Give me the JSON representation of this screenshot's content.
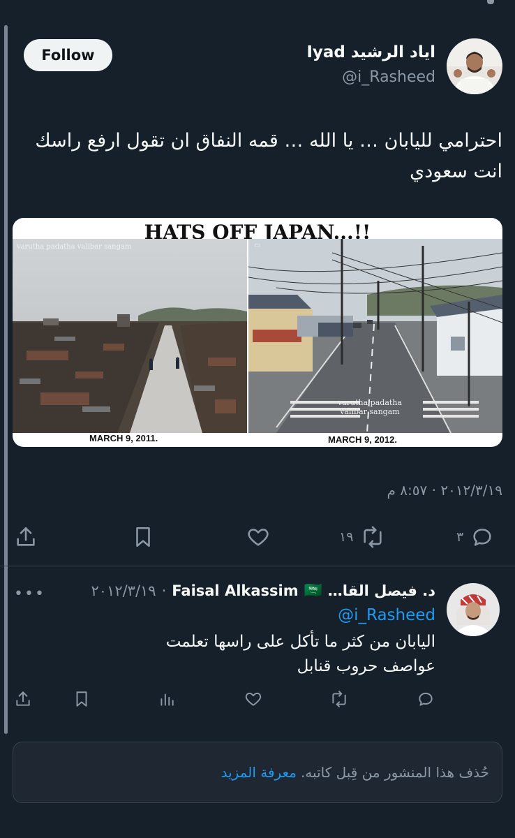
{
  "tweet": {
    "display_name": "اياد الرشيد Iyad",
    "handle": "@i_Rasheed",
    "follow_label": "Follow",
    "text_line1": "احترامي لليابان … يا الله … قمه النفاق ان تقول ارفع راسك",
    "text_line2": "انت سعودي",
    "media": {
      "title": "HATS OFF JAPAN...!!",
      "left_caption": "MARCH 9, 2011.",
      "right_caption": "MARCH 9, 2012.",
      "watermark": "varutha padatha valibar sangam",
      "watermark_line1": "varutha padatha",
      "watermark_line2": "valibar sangam"
    },
    "timestamp": "٢٠١٢/٣/١٩ · ٨:٥٧ م",
    "actions": {
      "replies": "٣",
      "retweets": "١٩"
    }
  },
  "reply": {
    "display_name": "د. فيصل القا…",
    "flag": "🇸🇦",
    "name_latin": "Faisal Alkassim",
    "time": "٢٠١٢/٣/١٩",
    "more_label": "•••",
    "mention": "@i_Rasheed",
    "text_line1": "اليابان من كثر ما تأكل على راسها تعلمت",
    "text_line2": "عواصف حروب قنابل"
  },
  "notice": {
    "text": "حُذف هذا المنشور من قِبل كاتبه.",
    "link": "معرفة المزيد"
  },
  "colors": {
    "background": "#15202b",
    "text": "#f7f9f9",
    "muted": "#8b98a5",
    "accent": "#1d9bf0",
    "border": "#38444d"
  },
  "icons": {
    "reply": "reply-icon",
    "retweet": "retweet-icon",
    "like": "heart-icon",
    "bookmark": "bookmark-icon",
    "share": "share-icon",
    "views": "views-icon"
  }
}
